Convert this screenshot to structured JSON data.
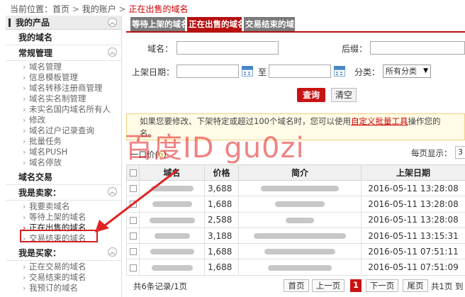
{
  "breadcrumb": {
    "prefix": "当前位置：",
    "home": "首页",
    "sep": ">",
    "account": "我的账户",
    "current": "正在出售的域名"
  },
  "sidebar": {
    "header": "我的产品",
    "my_domains": "我的域名",
    "groups": [
      {
        "title": "常规管理",
        "items": [
          "域名管理",
          "信息模板管理",
          "域名转移注册商管理",
          "域名实名制管理",
          "未实名国内域名所有人",
          "修改",
          "域名过户记录查询",
          "批量任务",
          "域名PUSH",
          "域名停放"
        ]
      },
      {
        "title": "域名交易",
        "items": []
      },
      {
        "title": "我是卖家：",
        "items": [
          "我要卖域名",
          "等待上架的域名",
          "正在出售的域名",
          "交易结束的域名"
        ]
      },
      {
        "title": "我是买家：",
        "items": [
          "正在交易的域名",
          "交易结束的域名",
          "我预订的域名"
        ]
      }
    ],
    "active_item": "正在出售的域名"
  },
  "tabs": [
    {
      "label": "等待上架的域名",
      "active": false
    },
    {
      "label": "正在出售的域名",
      "active": true
    },
    {
      "label": "交易结束的域名",
      "active": false
    }
  ],
  "search": {
    "domain_label": "域名：",
    "suffix_label": "后缀：",
    "date_label": "上架日期：",
    "to_label": "至",
    "category_label": "分类：",
    "category_value": "所有分类",
    "query_button": "查询",
    "clear_button": "清空"
  },
  "notice": {
    "text_before": "如果您要修改、下架特定或超过100个域名时，您可以使用",
    "link": "自定义批量工具",
    "text_after": "操作您的",
    "line2": "名。"
  },
  "watermark": "百度ID gu0zi",
  "toolbar": {
    "count_prefix": "一口价(",
    "count_value": "6",
    "count_suffix": ")",
    "page_size_label": "每页显示：",
    "page_size_value": "3"
  },
  "table": {
    "columns": [
      "域名",
      "价格",
      "简介",
      "上架日期"
    ],
    "rows": [
      {
        "price": "3,688",
        "date": "2016-05-11 13:28:08"
      },
      {
        "price": "1,688",
        "date": "2016-05-11 13:28:08"
      },
      {
        "price": "2,588",
        "date": "2016-05-11 13:28:08"
      },
      {
        "price": "3,188",
        "date": "2016-05-11 13:15:31"
      },
      {
        "price": "1,688",
        "date": "2016-05-11 07:51:11"
      },
      {
        "price": "1,688",
        "date": "2016-05-11 07:51:09"
      }
    ]
  },
  "pager": {
    "summary": "共6条记录/1页",
    "first": "首页",
    "prev": "上一页",
    "current": "1",
    "next": "下一页",
    "last": "尾页",
    "total": "共1页 到"
  },
  "colors": {
    "accent": "#c81313",
    "highlight_box": "#d42020",
    "watermark": "#e11e1e"
  }
}
